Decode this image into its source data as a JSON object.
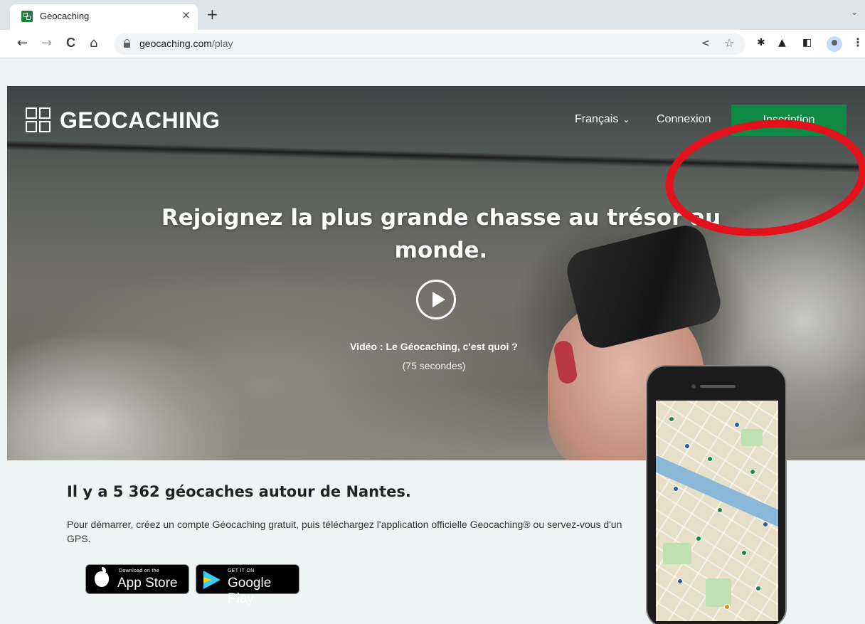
{
  "browser": {
    "tab_title": "Geocaching",
    "tab_close": "×",
    "new_tab": "+",
    "tab_menu": "⌄",
    "url_host": "geocaching.com",
    "url_path": "/play",
    "nav": {
      "back": "←",
      "forward": "→",
      "reload": "C",
      "home": "⌂"
    },
    "share": "<",
    "bookmark": "☆",
    "kebab": "⋮"
  },
  "site": {
    "brand": "GEOCACHING",
    "nav": {
      "language": "Français",
      "language_chevron": "⌄",
      "login": "Connexion",
      "signup": "Inscription"
    },
    "hero": {
      "title_line1": "Rejoignez la plus grande chasse au trésor au",
      "title_line2": "monde.",
      "video_label": "Vidéo : Le Géocaching, c'est quoi ?",
      "video_duration": "(75 secondes)"
    },
    "content": {
      "title": "Il y a 5 362 géocaches autour de Nantes.",
      "body": "Pour démarrer, créez un compte Géocaching gratuit, puis téléchargez l'application officielle Geocaching® ou servez-vous d'un GPS."
    },
    "badges": {
      "appstore_small": "Download on the",
      "appstore_large": "App Store",
      "googleplay_small": "GET IT ON",
      "googleplay_large": "Google Play"
    }
  },
  "colors": {
    "signup_green": "#0e8a44",
    "annotation_red": "#e3111b"
  }
}
